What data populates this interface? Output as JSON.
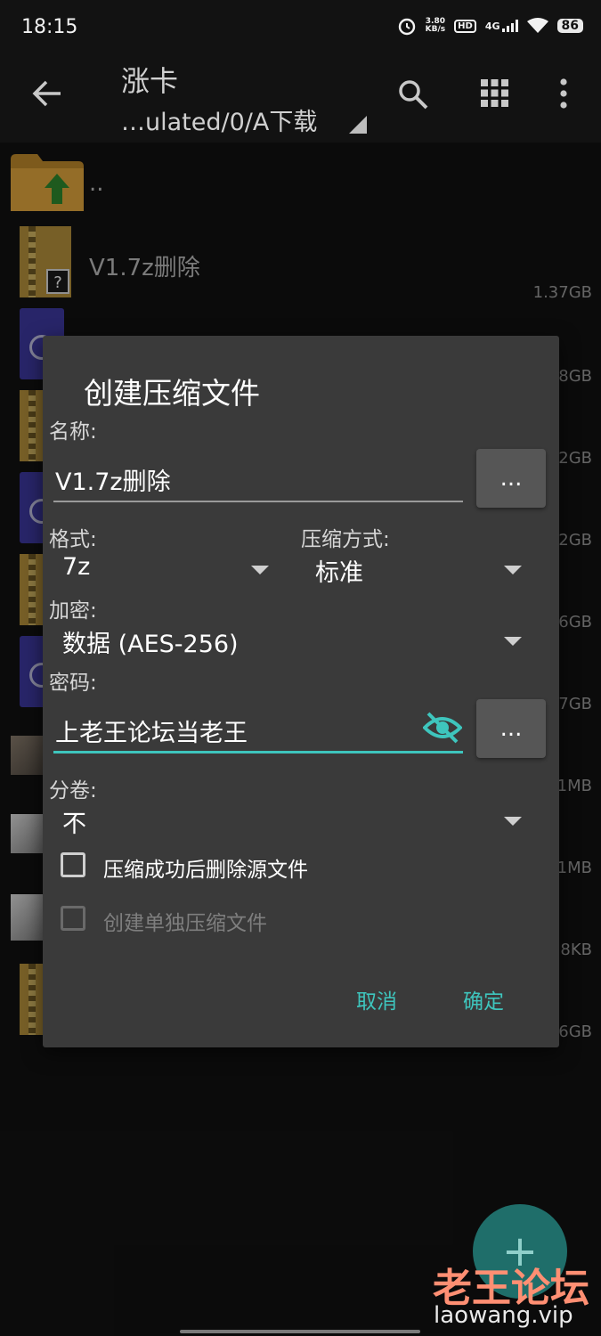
{
  "status_bar": {
    "time": "18:15",
    "speed_value": "3.80",
    "speed_unit": "KB/s",
    "hd": "HD",
    "network": "4G",
    "battery": "86"
  },
  "toolbar": {
    "title": "涨卡",
    "path": "…ulated/0/A下载",
    "icons": [
      "back-arrow-icon",
      "search-icon",
      "grid-view-icon",
      "more-vert-icon"
    ]
  },
  "files": [
    {
      "name": "..",
      "size": ""
    },
    {
      "name": "V1.7z删除",
      "size": "1.37GB"
    },
    {
      "name": "",
      "size": "8GB"
    },
    {
      "name": "",
      "size": "2GB"
    },
    {
      "name": "",
      "size": "2GB"
    },
    {
      "name": "",
      "size": "6GB"
    },
    {
      "name": "",
      "size": "7GB"
    },
    {
      "name": "",
      "size": "1MB"
    },
    {
      "name": "",
      "size": "1MB"
    },
    {
      "name": "",
      "size": "8KB"
    },
    {
      "name": "",
      "size": "6GB"
    }
  ],
  "dialog": {
    "title": "创建压缩文件",
    "name_label": "名称:",
    "name_value": "V1.7z删除",
    "more_label": "...",
    "format_label": "格式:",
    "format_value": "7z",
    "method_label": "压缩方式:",
    "method_value": "标准",
    "encryption_label": "加密:",
    "encryption_value": "数据 (AES-256)",
    "password_label": "密码:",
    "password_value": "上老王论坛当老王",
    "volume_label": "分卷:",
    "volume_value": "不",
    "delete_source_label": "压缩成功后删除源文件",
    "separate_archive_label": "创建单独压缩文件",
    "cancel_label": "取消",
    "ok_label": "确定"
  },
  "fab_label": "+",
  "watermark": {
    "line1": "老王论坛",
    "line2": "laowang.vip"
  },
  "colors": {
    "accent": "#3ec5bd",
    "dialog_bg": "#3a3a3a",
    "background": "#121212"
  }
}
